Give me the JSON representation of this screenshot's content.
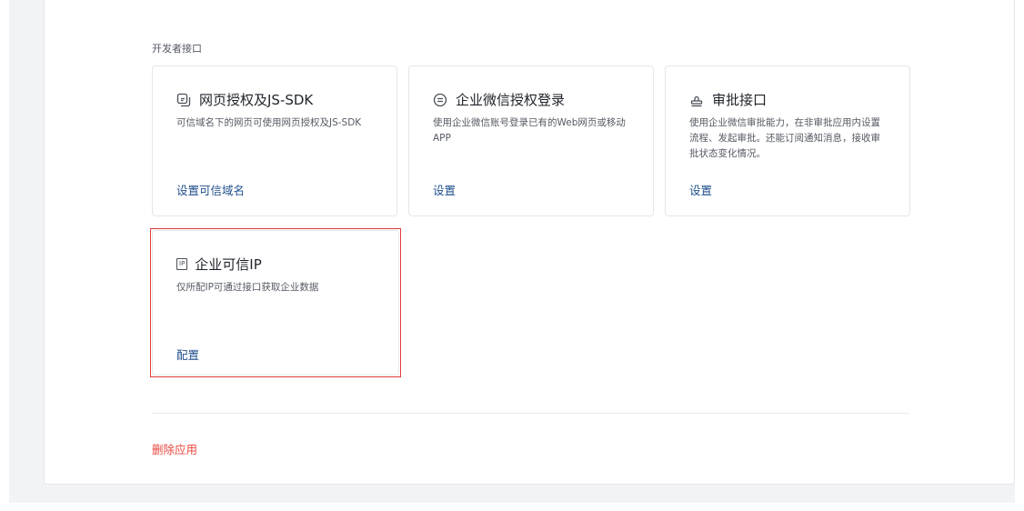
{
  "section": {
    "title": "开发者接口"
  },
  "cards": [
    {
      "icon": "webpage-auth-icon",
      "title": "网页授权及JS-SDK",
      "desc": "可信域名下的网页可使用网页授权及JS-SDK",
      "link": "设置可信域名"
    },
    {
      "icon": "wecom-login-icon",
      "title": "企业微信授权登录",
      "desc": "使用企业微信账号登录已有的Web网页或移动APP",
      "link": "设置"
    },
    {
      "icon": "approval-stamp-icon",
      "title": "审批接口",
      "desc": "使用企业微信审批能力，在非审批应用内设置流程、发起审批。还能订阅通知消息，接收审批状态变化情况。",
      "link": "设置"
    },
    {
      "icon_text": "IP",
      "title": "企业可信IP",
      "desc": "仅所配IP可通过接口获取企业数据",
      "link": "配置"
    }
  ],
  "footer": {
    "delete_label": "删除应用"
  },
  "colors": {
    "link": "#1f4f8b",
    "danger": "#e8453c",
    "highlight": "#e03b3b"
  }
}
